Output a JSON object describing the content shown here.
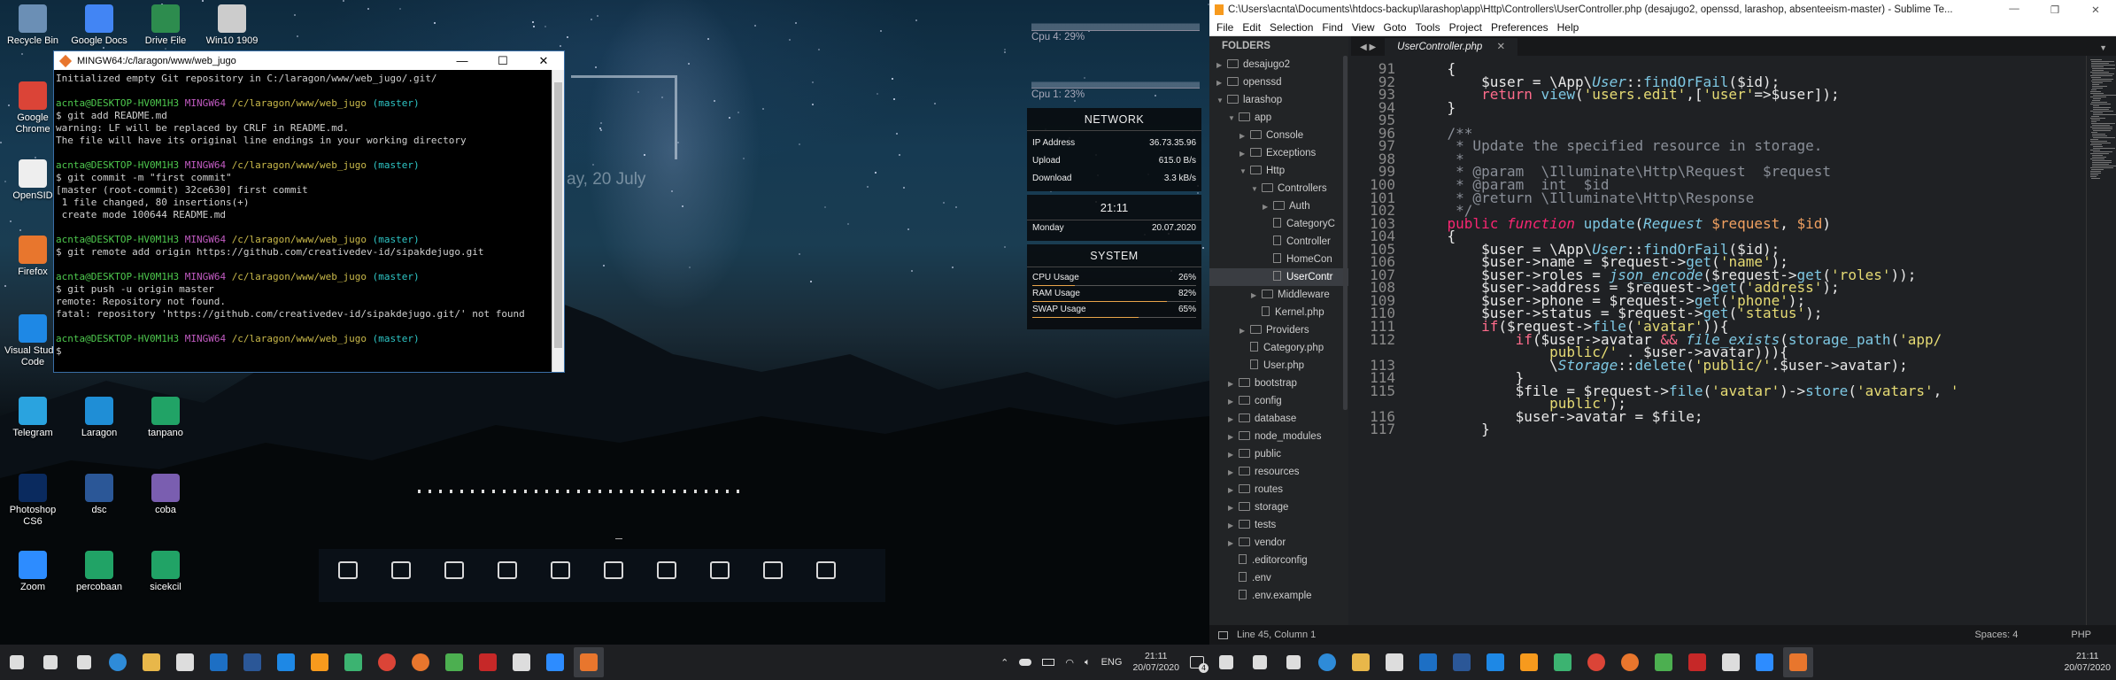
{
  "desktop": {
    "icons": [
      {
        "label": "Recycle Bin",
        "color": "#6b8fb5"
      },
      {
        "label": "Google Docs",
        "color": "#4285f4"
      },
      {
        "label": "Drive File",
        "color": "#2d8c4e"
      },
      {
        "label": "Win10 1909",
        "color": "#cccccc"
      },
      {
        "label": "Google Chrome",
        "color": "#db4437"
      },
      {
        "label": "OpenSID",
        "color": "#eeeeee"
      },
      {
        "label": "Firefox",
        "color": "#e8762d"
      },
      {
        "label": "Visual Studio Code",
        "color": "#1e88e5"
      },
      {
        "label": "Telegram",
        "color": "#2aa3df"
      },
      {
        "label": "Laragon",
        "color": "#1f8ed6"
      },
      {
        "label": "tanpano",
        "color": "#21a366"
      },
      {
        "label": "Photoshop CS6",
        "color": "#0a2a5e"
      },
      {
        "label": "dsc",
        "color": "#2b5797"
      },
      {
        "label": "coba",
        "color": "#7a5eb0"
      },
      {
        "label": "Zoom",
        "color": "#2d8cff"
      },
      {
        "label": "percobaan",
        "color": "#21a366"
      },
      {
        "label": "sicekcil",
        "color": "#21a366"
      }
    ],
    "clock_date": "ay, 20 July",
    "dock_icons": [
      "monitor-icon",
      "document-icon",
      "film-icon",
      "image-icon",
      "headphones-icon",
      "download-icon",
      "chrome-icon",
      "facebook-icon",
      "mail-icon",
      "pin-icon"
    ]
  },
  "terminal": {
    "title": "MINGW64:/c/laragon/www/web_jugo",
    "lines": [
      {
        "t": "Initialized empty Git repository in C:/laragon/www/web_jugo/.git/"
      },
      {
        "t": ""
      },
      {
        "prompt": true,
        "user": "acnta@DESKTOP-HV0M1H3",
        "env": "MINGW64",
        "path": "/c/laragon/www/web_jugo",
        "branch": "(master)"
      },
      {
        "t": "$ git add README.md"
      },
      {
        "t": "warning: LF will be replaced by CRLF in README.md."
      },
      {
        "t": "The file will have its original line endings in your working directory"
      },
      {
        "t": ""
      },
      {
        "prompt": true,
        "user": "acnta@DESKTOP-HV0M1H3",
        "env": "MINGW64",
        "path": "/c/laragon/www/web_jugo",
        "branch": "(master)"
      },
      {
        "t": "$ git commit -m \"first commit\""
      },
      {
        "t": "[master (root-commit) 32ce630] first commit"
      },
      {
        "t": " 1 file changed, 80 insertions(+)"
      },
      {
        "t": " create mode 100644 README.md"
      },
      {
        "t": ""
      },
      {
        "prompt": true,
        "user": "acnta@DESKTOP-HV0M1H3",
        "env": "MINGW64",
        "path": "/c/laragon/www/web_jugo",
        "branch": "(master)"
      },
      {
        "t": "$ git remote add origin https://github.com/creativedev-id/sipakdejugo.git"
      },
      {
        "t": ""
      },
      {
        "prompt": true,
        "user": "acnta@DESKTOP-HV0M1H3",
        "env": "MINGW64",
        "path": "/c/laragon/www/web_jugo",
        "branch": "(master)"
      },
      {
        "t": "$ git push -u origin master"
      },
      {
        "t": "remote: Repository not found."
      },
      {
        "t": "fatal: repository 'https://github.com/creativedev-id/sipakdejugo.git/' not found"
      },
      {
        "t": ""
      },
      {
        "prompt": true,
        "user": "acnta@DESKTOP-HV0M1H3",
        "env": "MINGW64",
        "path": "/c/laragon/www/web_jugo",
        "branch": "(master)"
      },
      {
        "t": "$"
      }
    ]
  },
  "cpu": {
    "cpu4": "Cpu 4: 29%",
    "cpu1": "Cpu 1: 23%"
  },
  "network": {
    "title": "NETWORK",
    "rows": [
      {
        "k": "IP Address",
        "v": "36.73.35.96"
      },
      {
        "k": "Upload",
        "v": "615.0 B/s"
      },
      {
        "k": "Download",
        "v": "3.3 kB/s"
      }
    ]
  },
  "clock": {
    "time": "21:11",
    "day": "Monday",
    "date": "20.07.2020"
  },
  "system": {
    "title": "SYSTEM",
    "rows": [
      {
        "k": "CPU Usage",
        "v": "26%",
        "p": 0.26
      },
      {
        "k": "RAM Usage",
        "v": "82%",
        "p": 0.82
      },
      {
        "k": "SWAP Usage",
        "v": "65%",
        "p": 0.65
      }
    ]
  },
  "sublime": {
    "title": "C:\\Users\\acnta\\Documents\\htdocs-backup\\larashop\\app\\Http\\Controllers\\UserController.php (desajugo2, openssd, larashop, absenteeism-master) - Sublime Te...",
    "menu": [
      "File",
      "Edit",
      "Selection",
      "Find",
      "View",
      "Goto",
      "Tools",
      "Project",
      "Preferences",
      "Help"
    ],
    "folders_header": "FOLDERS",
    "tree": [
      {
        "label": "desajugo2",
        "d": 0,
        "type": "folder",
        "arrow": "▶"
      },
      {
        "label": "openssd",
        "d": 0,
        "type": "folder",
        "arrow": "▶"
      },
      {
        "label": "larashop",
        "d": 0,
        "type": "folder",
        "arrow": "▼"
      },
      {
        "label": "app",
        "d": 1,
        "type": "folder",
        "arrow": "▼"
      },
      {
        "label": "Console",
        "d": 2,
        "type": "folder",
        "arrow": "▶"
      },
      {
        "label": "Exceptions",
        "d": 2,
        "type": "folder",
        "arrow": "▶"
      },
      {
        "label": "Http",
        "d": 2,
        "type": "folder",
        "arrow": "▼"
      },
      {
        "label": "Controllers",
        "d": 3,
        "type": "folder",
        "arrow": "▼"
      },
      {
        "label": "Auth",
        "d": 4,
        "type": "folder",
        "arrow": "▶"
      },
      {
        "label": "CategoryC",
        "d": 4,
        "type": "file"
      },
      {
        "label": "Controller",
        "d": 4,
        "type": "file"
      },
      {
        "label": "HomeCon",
        "d": 4,
        "type": "file"
      },
      {
        "label": "UserContr",
        "d": 4,
        "type": "file",
        "sel": true
      },
      {
        "label": "Middleware",
        "d": 3,
        "type": "folder",
        "arrow": "▶"
      },
      {
        "label": "Kernel.php",
        "d": 3,
        "type": "file"
      },
      {
        "label": "Providers",
        "d": 2,
        "type": "folder",
        "arrow": "▶"
      },
      {
        "label": "Category.php",
        "d": 2,
        "type": "file"
      },
      {
        "label": "User.php",
        "d": 2,
        "type": "file"
      },
      {
        "label": "bootstrap",
        "d": 1,
        "type": "folder",
        "arrow": "▶"
      },
      {
        "label": "config",
        "d": 1,
        "type": "folder",
        "arrow": "▶"
      },
      {
        "label": "database",
        "d": 1,
        "type": "folder",
        "arrow": "▶"
      },
      {
        "label": "node_modules",
        "d": 1,
        "type": "folder",
        "arrow": "▶"
      },
      {
        "label": "public",
        "d": 1,
        "type": "folder",
        "arrow": "▶"
      },
      {
        "label": "resources",
        "d": 1,
        "type": "folder",
        "arrow": "▶"
      },
      {
        "label": "routes",
        "d": 1,
        "type": "folder",
        "arrow": "▶"
      },
      {
        "label": "storage",
        "d": 1,
        "type": "folder",
        "arrow": "▶"
      },
      {
        "label": "tests",
        "d": 1,
        "type": "folder",
        "arrow": "▶"
      },
      {
        "label": "vendor",
        "d": 1,
        "type": "folder",
        "arrow": "▶"
      },
      {
        "label": ".editorconfig",
        "d": 1,
        "type": "file"
      },
      {
        "label": ".env",
        "d": 1,
        "type": "file"
      },
      {
        "label": ".env.example",
        "d": 1,
        "type": "file"
      }
    ],
    "tab": "UserController.php",
    "status_left": "Line 45, Column 1",
    "status_spaces": "Spaces: 4",
    "status_syntax": "PHP",
    "code": [
      {
        "n": "91",
        "h": "    {"
      },
      {
        "n": "92",
        "h": "        <span class='v'>$user</span> = \\App\\<span class='cls'>User</span>::<span class='f'>findOrFail</span>(<span class='v'>$id</span>);"
      },
      {
        "n": "93",
        "h": "        <span class='k'>return</span> <span class='f'>view</span>(<span class='s'>'users.edit'</span>,[<span class='s'>'user'</span>=&gt;<span class='v'>$user</span>]);"
      },
      {
        "n": "94",
        "h": "    }"
      },
      {
        "n": "95",
        "h": ""
      },
      {
        "n": "96",
        "h": "    <span class='cm'>/**</span>"
      },
      {
        "n": "97",
        "h": "<span class='cm'>     * Update the specified resource in storage.</span>"
      },
      {
        "n": "98",
        "h": "<span class='cm'>     *</span>"
      },
      {
        "n": "99",
        "h": "<span class='cm'>     * @param  \\Illuminate\\Http\\Request  $request</span>"
      },
      {
        "n": "100",
        "h": "<span class='cm'>     * @param  int  $id</span>"
      },
      {
        "n": "101",
        "h": "<span class='cm'>     * @return \\Illuminate\\Http\\Response</span>"
      },
      {
        "n": "102",
        "h": "<span class='cm'>     */</span>"
      },
      {
        "n": "103",
        "h": "    <span class='kw'>public</span> <span class='kw it'>function</span> <span class='f'>update</span>(<span class='cls'>Request</span> <span class='vr'>$request</span>, <span class='vr'>$id</span>)"
      },
      {
        "n": "104",
        "h": "    {"
      },
      {
        "n": "105",
        "h": "        <span class='v'>$user</span> = \\App\\<span class='cls'>User</span>::<span class='f'>findOrFail</span>(<span class='v'>$id</span>);"
      },
      {
        "n": "106",
        "h": "        <span class='v'>$user</span>-&gt;name = <span class='v'>$request</span>-&gt;<span class='f'>get</span>(<span class='s'>'name'</span>);"
      },
      {
        "n": "107",
        "h": "        <span class='v'>$user</span>-&gt;roles = <span class='f it'>json_encode</span>(<span class='v'>$request</span>-&gt;<span class='f'>get</span>(<span class='s'>'roles'</span>));"
      },
      {
        "n": "108",
        "h": "        <span class='v'>$user</span>-&gt;address = <span class='v'>$request</span>-&gt;<span class='f'>get</span>(<span class='s'>'address'</span>);"
      },
      {
        "n": "109",
        "h": "        <span class='v'>$user</span>-&gt;phone = <span class='v'>$request</span>-&gt;<span class='f'>get</span>(<span class='s'>'phone'</span>);"
      },
      {
        "n": "110",
        "h": "        <span class='v'>$user</span>-&gt;status = <span class='v'>$request</span>-&gt;<span class='f'>get</span>(<span class='s'>'status'</span>);"
      },
      {
        "n": "111",
        "h": "        <span class='k'>if</span>(<span class='v'>$request</span>-&gt;<span class='f'>file</span>(<span class='s'>'avatar'</span>)){"
      },
      {
        "n": "112",
        "h": "            <span class='k'>if</span>(<span class='v'>$user</span>-&gt;avatar <span class='k'>&amp;&amp;</span> <span class='f it'>file_exists</span>(<span class='f'>storage_path</span>(<span class='s'>'app/</span>"
      },
      {
        "n": "",
        "h": "<span class='s'>                public/'</span> . <span class='v'>$user</span>-&gt;avatar))){"
      },
      {
        "n": "113",
        "h": "                \\<span class='cls'>Storage</span>::<span class='f'>delete</span>(<span class='s'>'public/'</span>.<span class='v'>$user</span>-&gt;avatar);"
      },
      {
        "n": "114",
        "h": "            }"
      },
      {
        "n": "115",
        "h": "            <span class='v'>$file</span> = <span class='v'>$request</span>-&gt;<span class='f'>file</span>(<span class='s'>'avatar'</span>)-&gt;<span class='f'>store</span>(<span class='s'>'avatars'</span>, <span class='s'>'</span>"
      },
      {
        "n": "",
        "h": "<span class='s'>                public'</span>);"
      },
      {
        "n": "116",
        "h": "            <span class='v'>$user</span>-&gt;avatar = <span class='v'>$file</span>;"
      },
      {
        "n": "117",
        "h": "        }"
      }
    ]
  },
  "taskbar_left": {
    "apps": [
      "windows-start-icon",
      "search-icon",
      "task-view-icon",
      "edge-icon",
      "file-explorer-icon",
      "store-icon",
      "mail-icon",
      "word-icon",
      "vscode-icon",
      "sublime-icon",
      "app-icon",
      "chrome-icon",
      "firefox-icon",
      "app2-icon",
      "badge-app-icon",
      "settings-icon",
      "network-app-icon",
      "git-icon"
    ],
    "tray": {
      "lang": "ENG",
      "time": "21:11",
      "date": "20/07/2020",
      "notif": "4"
    }
  },
  "taskbar_right": {
    "apps": [
      "windows-start-icon",
      "search-icon",
      "task-view-icon",
      "edge-icon",
      "file-explorer-icon",
      "store-icon",
      "mail-icon",
      "word-icon",
      "vscode-icon",
      "sublime-icon",
      "app-icon",
      "chrome-icon",
      "firefox-icon",
      "app2-icon",
      "badge-app-icon",
      "settings-icon",
      "network-app-icon",
      "git-icon"
    ],
    "tray": {
      "time": "21:11",
      "date": "20/07/2020"
    }
  }
}
